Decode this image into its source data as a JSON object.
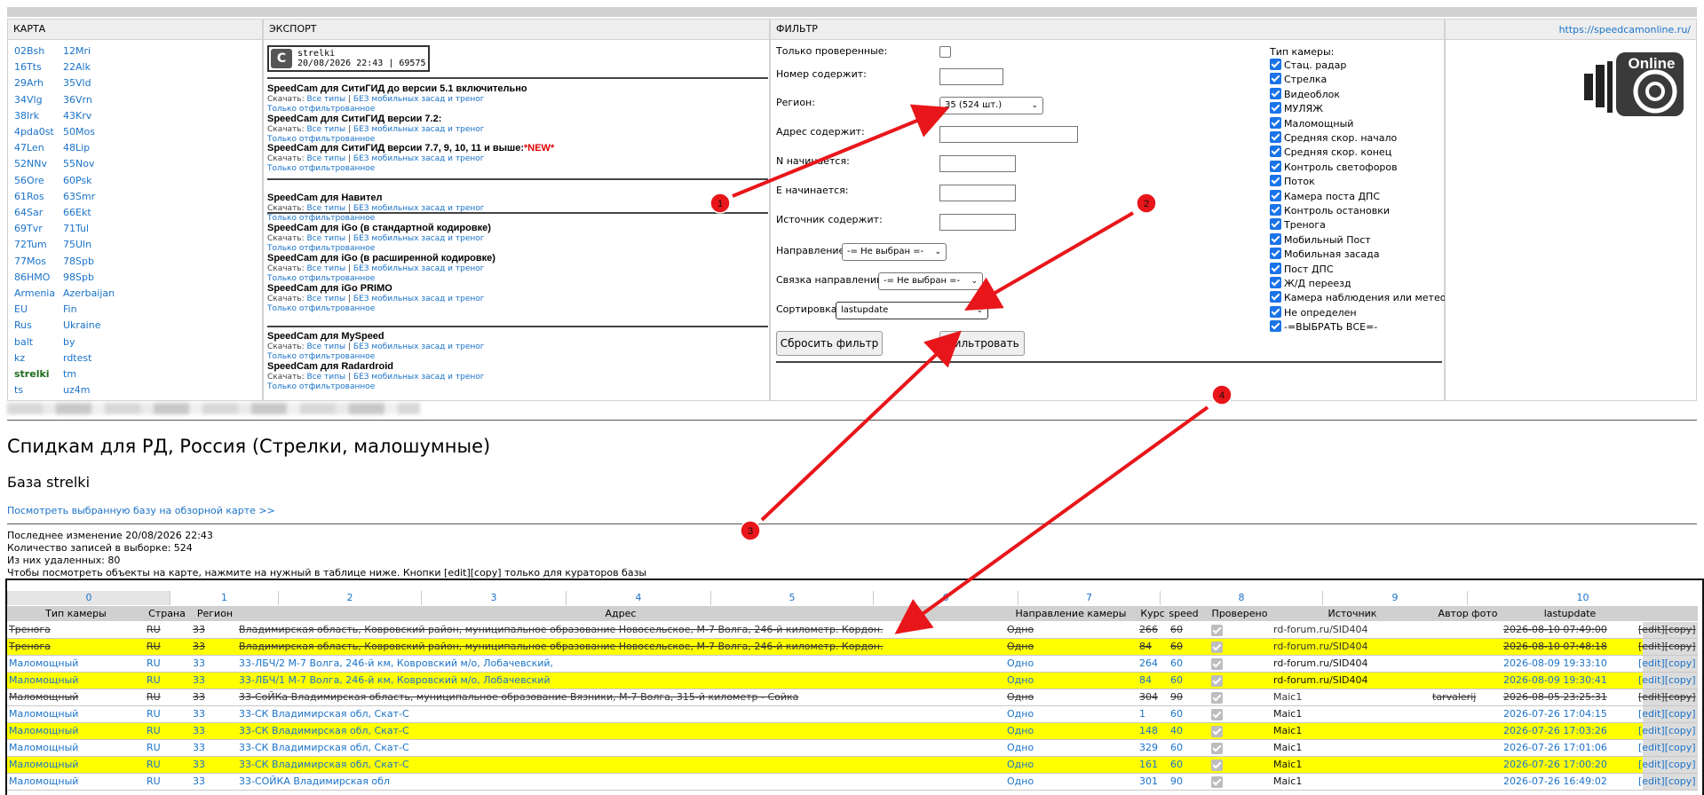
{
  "header": {
    "map_title": "КАРТА",
    "export_title": "ЭКСПОРТ",
    "filter_title": "ФИЛЬТР",
    "site_link": "https://speedcamonline.ru/"
  },
  "map": {
    "col1": [
      "02Bsh",
      "16Tts",
      "29Arh",
      "34Vlg",
      "38Irk",
      "4pda0st",
      "47Len",
      "52NNv",
      "56Ore",
      "61Ros",
      "64Sar",
      "69Tvr",
      "72Tum",
      "77Mos",
      "86HMO",
      "Armenia",
      "EU",
      "Rus",
      "balt",
      "kz",
      "strelki",
      "ts"
    ],
    "col2": [
      "12Mri",
      "22Alk",
      "35Vld",
      "36Vrn",
      "43Krv",
      "50Mos",
      "48Lip",
      "55Nov",
      "60Psk",
      "63Smr",
      "66Ekt",
      "71Tul",
      "75Uln",
      "78Spb",
      "98Spb",
      "Azerbaijan",
      "Fin",
      "Ukraine",
      "by",
      "rdtest",
      "tm",
      "uz4m"
    ]
  },
  "export": {
    "logo_line1": "strelki",
    "logo_line2": "20/08/2026 22:43 | 69575",
    "download_label": "Скачать:",
    "all_types": "Все типы",
    "no_mobile": "БЕЗ мобильных засад и треног",
    "filtered_only": "Только отфильтрованное",
    "items": [
      {
        "title": "SpeedCam для СитиГИД до версии 5.1 включительно",
        "new": ""
      },
      {
        "title": "SpeedCam для СитиГИД версии 7.2:",
        "new": ""
      },
      {
        "title": "SpeedCam для СитиГИД версии 7.7, 9, 10, 11 и выше:",
        "new": "*NEW*"
      },
      {
        "title": "SpeedCam для Навител",
        "new": ""
      },
      {
        "title": "SpeedCam для iGo (в стандартной кодировке)",
        "new": ""
      },
      {
        "title": "SpeedCam для iGo (в расширенной кодировке)",
        "new": ""
      },
      {
        "title": "SpeedCam для iGo PRIMO",
        "new": ""
      },
      {
        "title": "SpeedCam для MySpeed",
        "new": ""
      },
      {
        "title": "SpeedCam для Radardroid",
        "new": ""
      }
    ]
  },
  "filter": {
    "verified_only": "Только проверенные:",
    "number_contains": "Номер содержит:",
    "region": "Регион:",
    "region_value": "35 (524 шт.)",
    "address_contains": "Адрес содержит:",
    "n_starts": "N начинается:",
    "e_starts": "E начинается:",
    "source_contains": "Источник содержит:",
    "direction": "Направление:",
    "direction_value": "-= Не выбран =-",
    "direction_link": "Связка направлений:",
    "direction_link_value": "-= Не выбран =-",
    "sort": "Сортировка:",
    "sort_value": "lastupdate",
    "reset_button": "Сбросить фильтр",
    "apply_button": "Фильтровать",
    "camera_type_title": "Тип камеры:",
    "camera_types": [
      "Стац. радар",
      "Стрелка",
      "Видеоблок",
      "МУЛЯЖ",
      "Маломощный",
      "Средняя скор. начало",
      "Средняя скор. конец",
      "Контроль светофоров",
      "Поток",
      "Камера поста ДПС",
      "Контроль остановки",
      "Тренога",
      "Мобильный Пост",
      "Мобильная засада",
      "Пост ДПС",
      "Ж/Д переезд",
      "Камера наблюдения или метео",
      "Не определен",
      "-=ВЫБРАТЬ ВСЕ=-"
    ]
  },
  "site_logo_text": "Online",
  "page": {
    "title": "Спидкам для РД, Россия (Стрелки, малошумные)",
    "subtitle": "База strelki",
    "map_link": "Посмотреть выбранную базу на обзорной карте >>",
    "info": [
      "Последнее изменение 20/08/2026 22:43",
      "Количество записей в выборке: 524",
      "Из них удаленных: 80",
      "Чтобы посмотреть объекты на карте, нажмите на нужный в таблице ниже. Кнопки [edit][copy] только для кураторов базы"
    ]
  },
  "table": {
    "col_index": [
      "0",
      "1",
      "2",
      "3",
      "4",
      "5",
      "6",
      "7",
      "8",
      "9",
      "10"
    ],
    "headers": [
      "Тип камеры",
      "Страна",
      "Регион",
      "Адрес",
      "Направление камеры",
      "Курс",
      "speed",
      "Проверено",
      "Источник",
      "Автор фото",
      "lastupdate"
    ],
    "rows": [
      {
        "type": "Тренога",
        "country": "RU",
        "region": "33",
        "address": "Владимирская область, Ковровский район, муниципальное образование Новосельское, М-7 Волга, 246-й километр. Кордон.",
        "dir": "Одно",
        "course": "266",
        "speed": "60",
        "source": "rd-forum.ru/SID404",
        "author": "",
        "updated": "2026-08-10 07:49:00",
        "edit": "[edit][copy]",
        "deleted": true,
        "yellow": false
      },
      {
        "type": "Тренога",
        "country": "RU",
        "region": "33",
        "address": "Владимирская область, Ковровский район, муниципальное образование Новосельское, М-7 Волга, 246-й километр. Кордон.",
        "dir": "Одно",
        "course": "84",
        "speed": "60",
        "source": "rd-forum.ru/SID404",
        "author": "",
        "updated": "2026-08-10 07:48:18",
        "edit": "[edit][copy]",
        "deleted": true,
        "yellow": true
      },
      {
        "type": "Маломощный",
        "country": "RU",
        "region": "33",
        "address": "33-ЛБЧ/2 М-7 Волга, 246-й км, Ковровский м/о, Лобачевский,",
        "dir": "Одно",
        "course": "264",
        "speed": "60",
        "source": "rd-forum.ru/SID404",
        "author": "",
        "updated": "2026-08-09 19:33:10",
        "edit": "[edit][copy]",
        "deleted": false,
        "yellow": false
      },
      {
        "type": "Маломощный",
        "country": "RU",
        "region": "33",
        "address": "33-ЛБЧ/1 М-7 Волга, 246-й км, Ковровский м/о, Лобачевский",
        "dir": "Одно",
        "course": "84",
        "speed": "60",
        "source": "rd-forum.ru/SID404",
        "author": "",
        "updated": "2026-08-09 19:30:41",
        "edit": "[edit][copy]",
        "deleted": false,
        "yellow": true
      },
      {
        "type": "Маломощный",
        "country": "RU",
        "region": "33",
        "address": "33-СоЙКа Владимирская область, муниципальное образование Вязники, М-7 Волга, 315-й километр - Сойка",
        "dir": "Одно",
        "course": "304",
        "speed": "90",
        "source": "Maic1",
        "author": "tarvalerij",
        "updated": "2026-08-05 23:25:31",
        "edit": "[edit][copy]",
        "deleted": true,
        "yellow": false
      },
      {
        "type": "Маломощный",
        "country": "RU",
        "region": "33",
        "address": "33-СК Владимирская обл, Скат-С",
        "dir": "Одно",
        "course": "1",
        "speed": "60",
        "source": "Maic1",
        "author": "",
        "updated": "2026-07-26 17:04:15",
        "edit": "[edit][copy]",
        "deleted": false,
        "yellow": false
      },
      {
        "type": "Маломощный",
        "country": "RU",
        "region": "33",
        "address": "33-СК Владимирская обл, Скат-С",
        "dir": "Одно",
        "course": "148",
        "speed": "40",
        "source": "Maic1",
        "author": "",
        "updated": "2026-07-26 17:03:26",
        "edit": "[edit][copy]",
        "deleted": false,
        "yellow": true
      },
      {
        "type": "Маломощный",
        "country": "RU",
        "region": "33",
        "address": "33-СК Владимирская обл, Скат-С",
        "dir": "Одно",
        "course": "329",
        "speed": "60",
        "source": "Maic1",
        "author": "",
        "updated": "2026-07-26 17:01:06",
        "edit": "[edit][copy]",
        "deleted": false,
        "yellow": false
      },
      {
        "type": "Маломощный",
        "country": "RU",
        "region": "33",
        "address": "33-СК Владимирская обл, Скат-С",
        "dir": "Одно",
        "course": "161",
        "speed": "60",
        "source": "Maic1",
        "author": "",
        "updated": "2026-07-26 17:00:20",
        "edit": "[edit][copy]",
        "deleted": false,
        "yellow": true
      },
      {
        "type": "Маломощный",
        "country": "RU",
        "region": "33",
        "address": "33-СОЙКА Владимирская обл",
        "dir": "Одно",
        "course": "301",
        "speed": "90",
        "source": "Maic1",
        "author": "",
        "updated": "2026-07-26 16:49:02",
        "edit": "[edit][copy]",
        "deleted": false,
        "yellow": false
      }
    ]
  },
  "annotations": {
    "labels": [
      "1",
      "2",
      "3",
      "4"
    ],
    "arrow_color": "#e8161a"
  }
}
